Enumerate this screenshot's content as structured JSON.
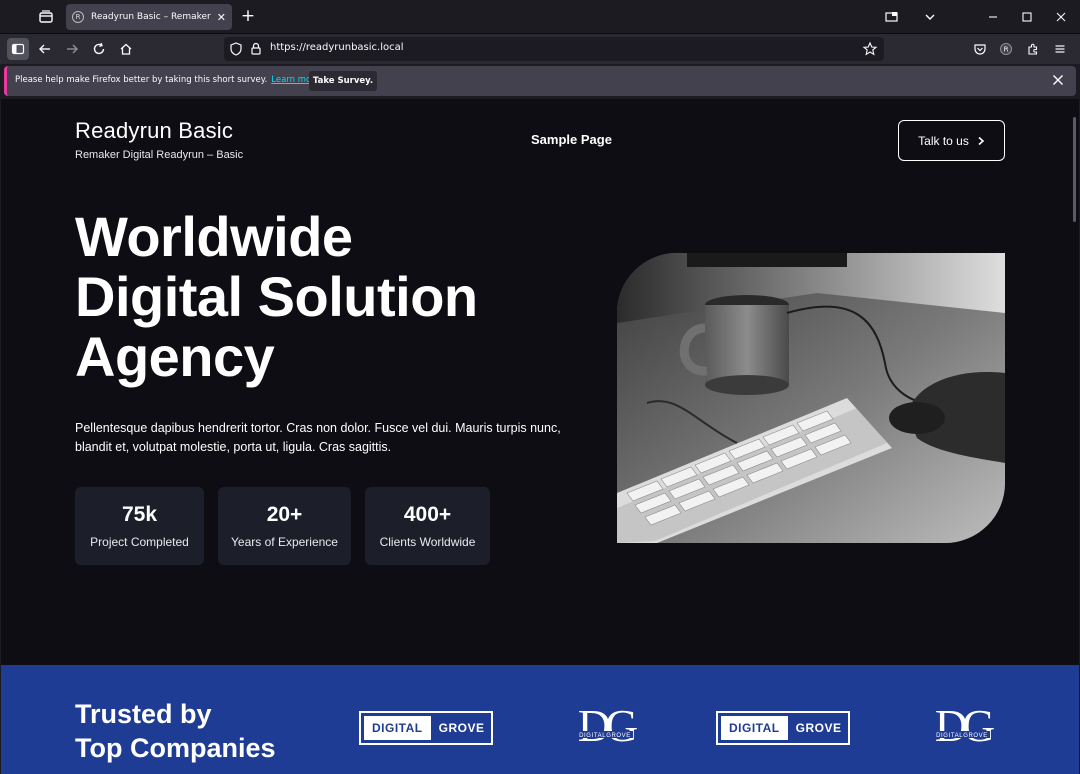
{
  "browser": {
    "tab_title": "Readyrun Basic – Remaker Digit",
    "tab_close": "✕",
    "new_tab": "+",
    "url": "https://readyrunbasic.local",
    "icons": [
      "tab-list-icon",
      "favicon-icon",
      "sidebar-icon",
      "back-icon",
      "forward-icon",
      "reload-icon",
      "home-icon",
      "shield-icon",
      "lock-icon",
      "star-icon",
      "pocket-icon",
      "account-icon",
      "extensions-icon",
      "menu-icon",
      "minimize-icon",
      "maximize-icon",
      "close-icon"
    ]
  },
  "notification": {
    "message": "Please help make Firefox better by taking this short survey.",
    "link": "Learn more.",
    "button": "Take Survey."
  },
  "site": {
    "title": "Readyrun Basic",
    "tagline": "Remaker Digital Readyrun – Basic",
    "nav": [
      "Sample Page"
    ],
    "cta": "Talk to us"
  },
  "hero": {
    "title_lines": [
      "Worldwide",
      "Digital Solution",
      "Agency"
    ],
    "text": "Pellentesque dapibus hendrerit tortor. Cras non dolor. Fusce vel dui. Mauris turpis nunc, blandit et, volutpat molestie, porta ut, ligula. Cras sagittis.",
    "stats": [
      {
        "value": "75k",
        "label": "Project Completed"
      },
      {
        "value": "20+",
        "label": "Years of Experience"
      },
      {
        "value": "400+",
        "label": "Clients Worldwide"
      }
    ]
  },
  "trusted": {
    "title_lines": [
      "Trusted by",
      "Top Companies"
    ],
    "logos": [
      {
        "type": "box",
        "left": "DIGITAL",
        "right": "GROVE"
      },
      {
        "type": "dg",
        "text": "DIGITALGROVE"
      },
      {
        "type": "box",
        "left": "DIGITAL",
        "right": "GROVE"
      },
      {
        "type": "dg",
        "text": "DIGITALGROVE"
      }
    ]
  },
  "colors": {
    "page_bg": "#0e0d13",
    "card_bg": "#1c1f2a",
    "trusted_bg": "#1e3c94",
    "accent_pink": "#e93aa1",
    "link_cyan": "#00ddff"
  }
}
